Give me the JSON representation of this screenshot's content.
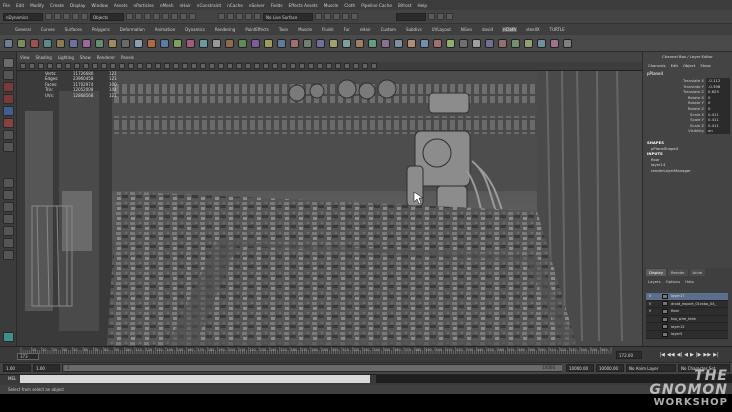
{
  "menubar": {
    "items": [
      "File",
      "Edit",
      "Modify",
      "Create",
      "Display",
      "Window",
      "Assets",
      "nParticles",
      "nMesh",
      "nHair",
      "nConstraint",
      "nCache",
      "nSolver",
      "Fields",
      "Effects Assets",
      "Muscle",
      "Cloth",
      "Pipeline Cache",
      "Bifrost",
      "Help"
    ]
  },
  "statusline": {
    "mode_menu": "nDynamics",
    "selection_mask": "Objects",
    "live_surface": "No Live Surface"
  },
  "shelf": {
    "tabs": [
      "General",
      "Curves",
      "Surfaces",
      "Polygons",
      "Deformation",
      "Animation",
      "Dynamics",
      "Rendering",
      "PaintEffects",
      "Toon",
      "Muscle",
      "Fluids",
      "Fur",
      "nHair",
      "Custom",
      "Subdivs",
      "UVLayout",
      "NGen",
      "david",
      "nCloth",
      "steelIX",
      "TURTLE"
    ],
    "active_tab": "nCloth",
    "icon_colors": [
      "#6c7f95",
      "#7b8c5a",
      "#a05050",
      "#5a8a8a",
      "#8a7a50",
      "#7070a0",
      "#9a6a9a",
      "#5f8f6f",
      "#a08a60",
      "#6a6a6a",
      "#8aa0b0",
      "#b06a40",
      "#5a7aa8",
      "#7fa05a",
      "#a05a7a",
      "#6a9aa0",
      "#999999",
      "#8c6c4c",
      "#5c8c5c",
      "#7c5c9c",
      "#9c9c5c",
      "#5c7c9c",
      "#a07070",
      "#708070",
      "#6f6f9f",
      "#a0a070",
      "#7fa0a0",
      "#9f7f5f",
      "#5f9f7f",
      "#8f6f8f",
      "#7f8f9f",
      "#af8f6f",
      "#6f8faf",
      "#9f6f6f",
      "#8faf6f",
      "#6f6f6f",
      "#a0a0a0",
      "#707090",
      "#907070",
      "#709070",
      "#90a070",
      "#7090a0",
      "#a07090",
      "#808080"
    ]
  },
  "panel": {
    "menu": [
      "View",
      "Shading",
      "Lighting",
      "Show",
      "Renderer",
      "Panels"
    ]
  },
  "hud": {
    "rows": [
      {
        "label": "Verts:",
        "value": "11726680",
        "extra": "121"
      },
      {
        "label": "Edges:",
        "value": "23960458",
        "extra": "121"
      },
      {
        "label": "Faces:",
        "value": "11702974",
        "extra": "100"
      },
      {
        "label": "Tris:",
        "value": "12052008",
        "extra": "144"
      },
      {
        "label": "UVs:",
        "value": "12868568",
        "extra": "121"
      }
    ]
  },
  "channelbox": {
    "title": "Channel Box / Layer Editor",
    "menu": [
      "Channels",
      "Edit",
      "Object",
      "Show"
    ],
    "object": "pPlane4",
    "attributes": [
      {
        "name": "Translate X",
        "value": "-0.112"
      },
      {
        "name": "Translate Y",
        "value": "-0.396"
      },
      {
        "name": "Translate Z",
        "value": "0.625"
      },
      {
        "name": "Rotate X",
        "value": "0"
      },
      {
        "name": "Rotate Y",
        "value": "0"
      },
      {
        "name": "Rotate Z",
        "value": "0"
      },
      {
        "name": "Scale X",
        "value": "0.411"
      },
      {
        "name": "Scale Y",
        "value": "0.411"
      },
      {
        "name": "Scale Z",
        "value": "0.411"
      },
      {
        "name": "Visibility",
        "value": "on"
      }
    ],
    "shapes_header": "SHAPES",
    "shapes": [
      "pPlaneShape4"
    ],
    "inputs_header": "INPUTS",
    "inputs": [
      "floor",
      "layer14",
      "renderLayerManager"
    ]
  },
  "layer_editor": {
    "tabs": [
      "Display",
      "Render",
      "Anim"
    ],
    "active_tab": "Display",
    "menu": [
      "Layers",
      "Options",
      "Help"
    ],
    "layers": [
      {
        "v": "V",
        "p": "",
        "name": "layer17",
        "selected": true
      },
      {
        "v": "V",
        "p": "",
        "name": "droid_export_01robo_04_",
        "selected": false
      },
      {
        "v": "V",
        "p": "",
        "name": "floor",
        "selected": false
      },
      {
        "v": "",
        "p": "",
        "name": "top_wire_hide",
        "selected": false
      },
      {
        "v": "",
        "p": "",
        "name": "layer12",
        "selected": false
      },
      {
        "v": "",
        "p": "",
        "name": "layer5",
        "selected": false
      }
    ]
  },
  "timeline": {
    "tick_labels": [
      "10",
      "20",
      "30",
      "40",
      "50",
      "60",
      "70",
      "80",
      "90",
      "100",
      "110",
      "120",
      "130",
      "140",
      "150",
      "160",
      "170",
      "180",
      "190",
      "200",
      "210",
      "220",
      "230",
      "240",
      "250",
      "260",
      "270",
      "280",
      "290",
      "300",
      "310",
      "320",
      "330",
      "340",
      "350",
      "360",
      "370",
      "380",
      "390",
      "400",
      "410",
      "420",
      "430",
      "440",
      "450",
      "460",
      "470",
      "480",
      "490",
      "500",
      "510",
      "520",
      "530",
      "540",
      "550",
      "560",
      "570"
    ],
    "current_frame": "373",
    "end_frame": "172.00",
    "play_controls": [
      "|◀",
      "◀◀",
      "◀|",
      "◀",
      "▶",
      "|▶",
      "▶▶",
      "▶|"
    ]
  },
  "range": {
    "start": "1.00",
    "inner_start": "1.00",
    "range_start_label": "1",
    "range_end_label": "10000",
    "end": "10000.00",
    "inner_end": "10000.00",
    "anim_layer": "No Anim Layer",
    "character_set": "No Character Set"
  },
  "command_line": {
    "label": "MEL"
  },
  "help_line": {
    "text": "Select from select an object"
  },
  "watermark": {
    "line1": "THE GNOMON",
    "line2": "WORKSHOP"
  }
}
